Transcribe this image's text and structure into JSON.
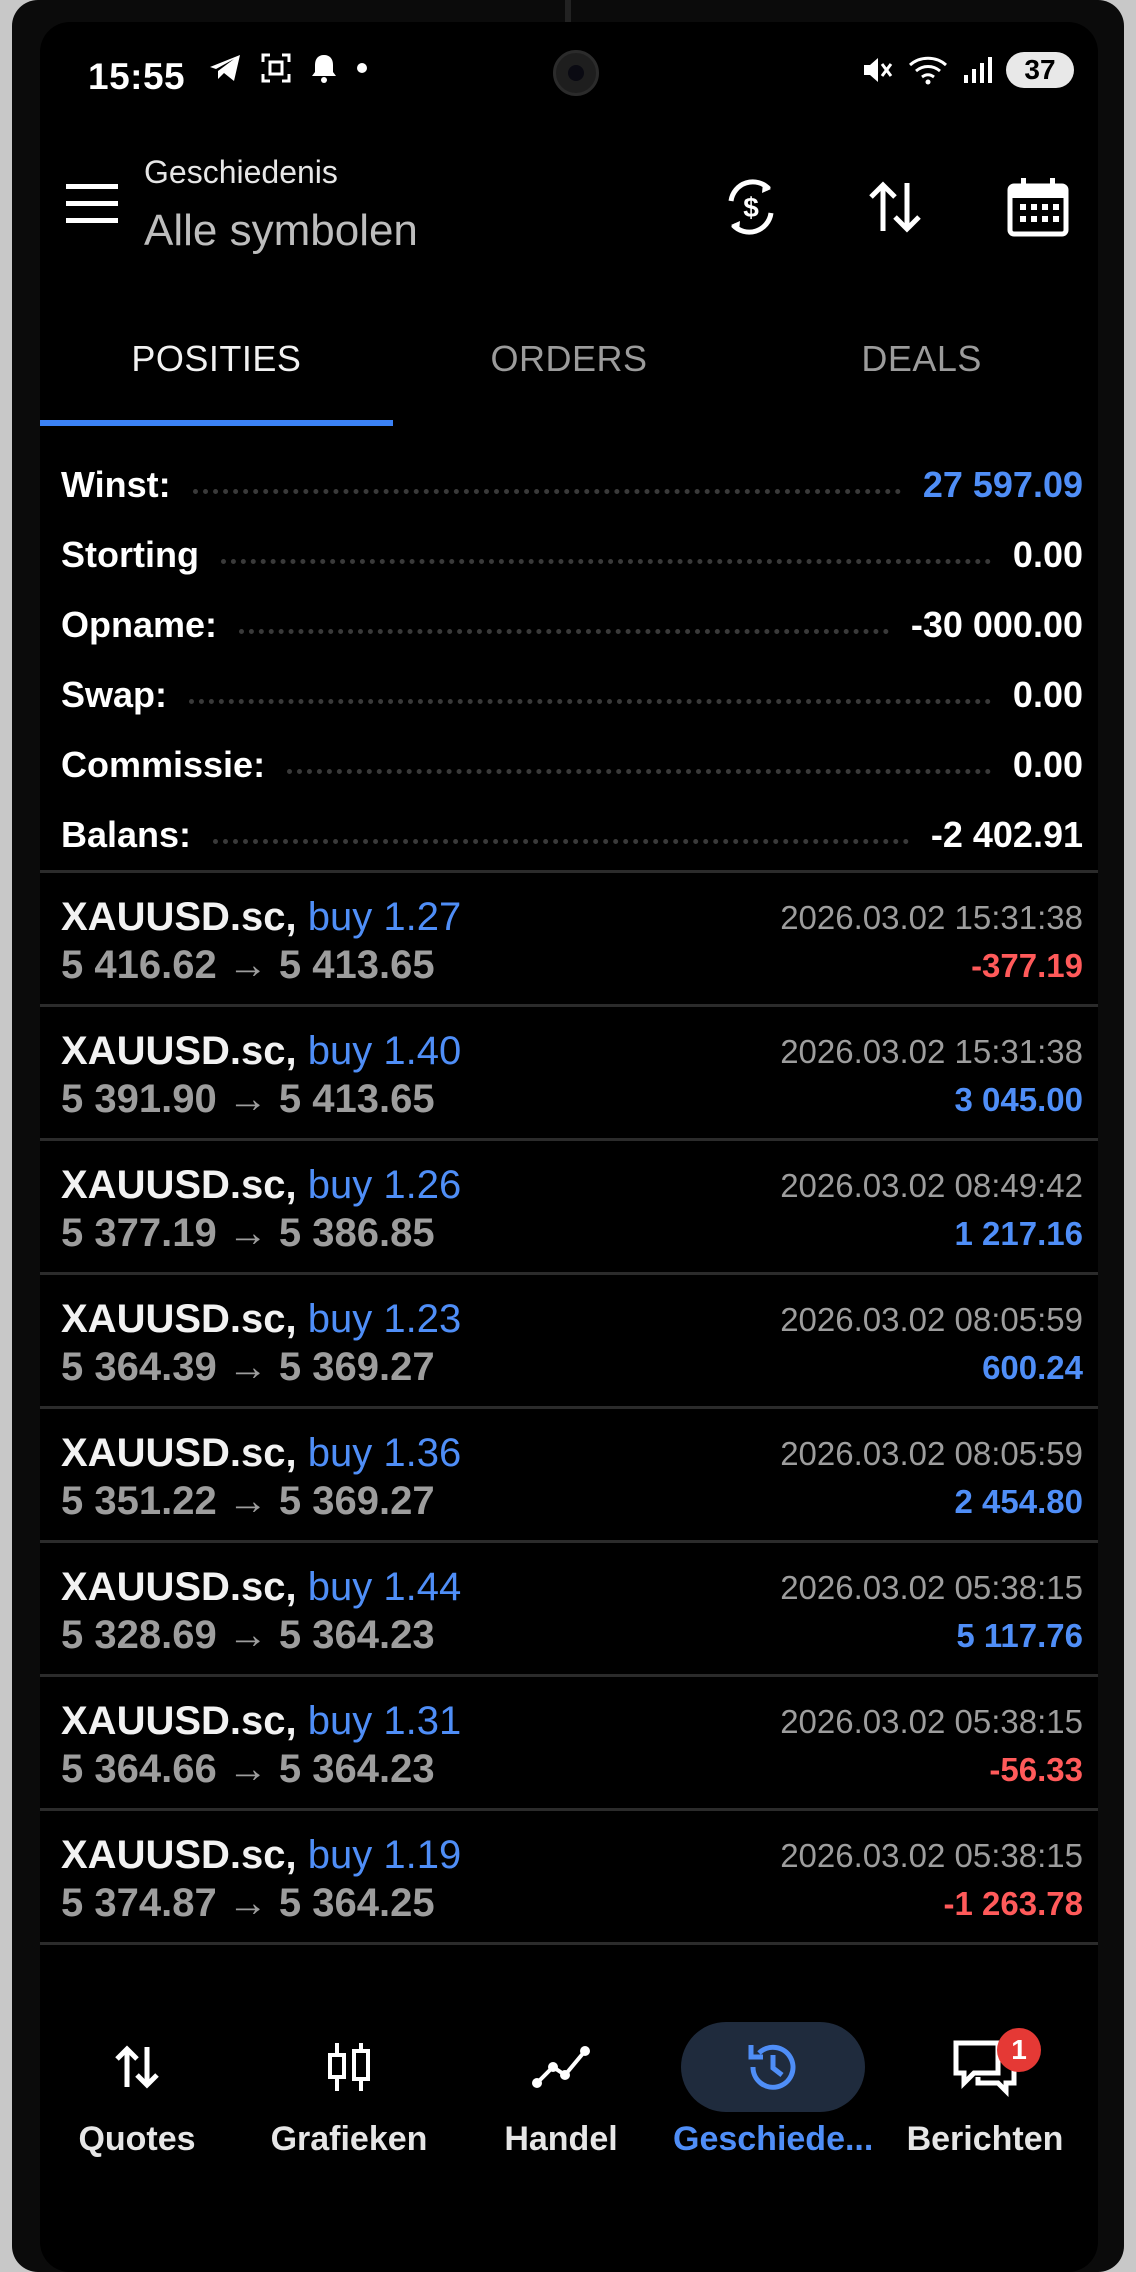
{
  "status": {
    "time": "15:55",
    "battery": "37"
  },
  "header": {
    "subtitle": "Geschiedenis",
    "title": "Alle symbolen"
  },
  "tabs": [
    {
      "label": "POSITIES",
      "active": true
    },
    {
      "label": "ORDERS",
      "active": false
    },
    {
      "label": "DEALS",
      "active": false
    }
  ],
  "summary": [
    {
      "label": "Winst:",
      "value": "27 597.09",
      "tone": "blue"
    },
    {
      "label": "Storting",
      "value": "0.00",
      "tone": "white"
    },
    {
      "label": "Opname:",
      "value": "-30 000.00",
      "tone": "white"
    },
    {
      "label": "Swap:",
      "value": "0.00",
      "tone": "white"
    },
    {
      "label": "Commissie:",
      "value": "0.00",
      "tone": "white"
    },
    {
      "label": "Balans:",
      "value": "-2 402.91",
      "tone": "white"
    }
  ],
  "deals": [
    {
      "symbol": "XAUUSD.sc,",
      "action": "buy 1.27",
      "prices": "5 416.62 → 5 413.65",
      "time": "2026.03.02 15:31:38",
      "pl": "-377.19",
      "tone": "red"
    },
    {
      "symbol": "XAUUSD.sc,",
      "action": "buy 1.40",
      "prices": "5 391.90 → 5 413.65",
      "time": "2026.03.02 15:31:38",
      "pl": "3 045.00",
      "tone": "blue"
    },
    {
      "symbol": "XAUUSD.sc,",
      "action": "buy 1.26",
      "prices": "5 377.19 → 5 386.85",
      "time": "2026.03.02 08:49:42",
      "pl": "1 217.16",
      "tone": "blue"
    },
    {
      "symbol": "XAUUSD.sc,",
      "action": "buy 1.23",
      "prices": "5 364.39 → 5 369.27",
      "time": "2026.03.02 08:05:59",
      "pl": "600.24",
      "tone": "blue"
    },
    {
      "symbol": "XAUUSD.sc,",
      "action": "buy 1.36",
      "prices": "5 351.22 → 5 369.27",
      "time": "2026.03.02 08:05:59",
      "pl": "2 454.80",
      "tone": "blue"
    },
    {
      "symbol": "XAUUSD.sc,",
      "action": "buy 1.44",
      "prices": "5 328.69 → 5 364.23",
      "time": "2026.03.02 05:38:15",
      "pl": "5 117.76",
      "tone": "blue"
    },
    {
      "symbol": "XAUUSD.sc,",
      "action": "buy 1.31",
      "prices": "5 364.66 → 5 364.23",
      "time": "2026.03.02 05:38:15",
      "pl": "-56.33",
      "tone": "red"
    },
    {
      "symbol": "XAUUSD.sc,",
      "action": "buy 1.19",
      "prices": "5 374.87 → 5 364.25",
      "time": "2026.03.02 05:38:15",
      "pl": "-1 263.78",
      "tone": "red"
    }
  ],
  "nav": [
    {
      "label": "Quotes",
      "icon": "quotes-icon",
      "active": false
    },
    {
      "label": "Grafieken",
      "icon": "charts-icon",
      "active": false
    },
    {
      "label": "Handel",
      "icon": "trade-icon",
      "active": false
    },
    {
      "label": "Geschiede...",
      "icon": "history-icon",
      "active": true
    },
    {
      "label": "Berichten",
      "icon": "messages-icon",
      "active": false,
      "badge": "1"
    }
  ],
  "colors": {
    "accent": "#4f8ef7",
    "loss": "#ff5a5a",
    "background": "#000000"
  }
}
